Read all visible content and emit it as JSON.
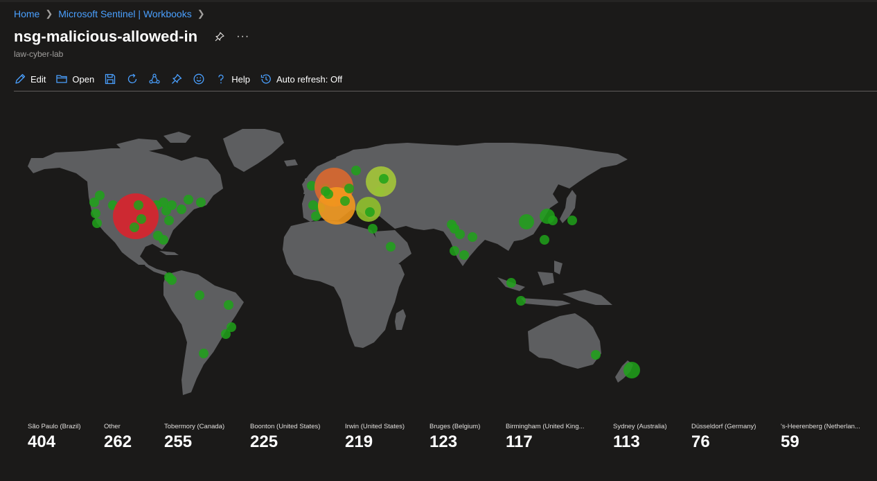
{
  "breadcrumb": {
    "home": "Home",
    "sentinel": "Microsoft Sentinel | Workbooks"
  },
  "header": {
    "title": "nsg-malicious-allowed-in",
    "subtitle": "law-cyber-lab",
    "more": "···"
  },
  "toolbar": {
    "edit": "Edit",
    "open": "Open",
    "help": "Help",
    "auto_refresh": "Auto refresh: Off"
  },
  "colors": {
    "background": "#1b1a19",
    "link": "#4aa0ff",
    "land": "#5d5e60",
    "icon_blue": "#4aa0ff",
    "bubble_green": "#1fa21a",
    "bubble_red": "#d9232e",
    "bubble_orange": "#f59a1d",
    "bubble_dark_orange": "#e2692b",
    "bubble_yellow_green": "#a4c639"
  },
  "tiles": [
    {
      "label": "São Paulo (Brazil)",
      "value": "404"
    },
    {
      "label": "Other",
      "value": "262"
    },
    {
      "label": "Tobermory (Canada)",
      "value": "255"
    },
    {
      "label": "Boonton (United States)",
      "value": "225"
    },
    {
      "label": "Irwin (United States)",
      "value": "219"
    },
    {
      "label": "Bruges (Belgium)",
      "value": "123"
    },
    {
      "label": "Birmingham (United King...",
      "value": "117"
    },
    {
      "label": "Sydney (Australia)",
      "value": "113"
    },
    {
      "label": "Düsseldorf (Germany)",
      "value": "76"
    },
    {
      "label": "'s-Heerenberg (Netherlan...",
      "value": "59"
    }
  ]
}
